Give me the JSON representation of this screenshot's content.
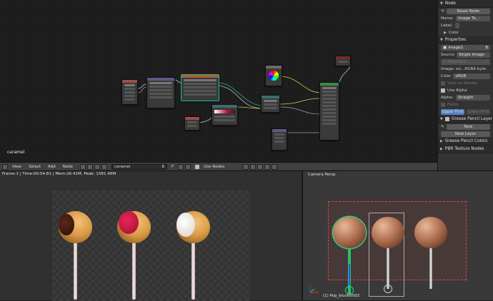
{
  "node_editor": {
    "canvas_label": "caramel",
    "header": {
      "menus": [
        "View",
        "Select",
        "Add",
        "Node"
      ],
      "material_name": "caramel",
      "user_count": "8",
      "fake_user": "F",
      "use_nodes_label": "Use Nodes"
    }
  },
  "sidebar": {
    "node_panel_title": "Node",
    "reset_button": "Reset Node",
    "name_label": "Name:",
    "name_value": "Image Te...",
    "label_label": "Label:",
    "color_title": "Color",
    "properties_title": "Properties",
    "image_name": "image2.",
    "image_users": "8",
    "source_label": "Source",
    "source_value": "Single Image",
    "path_value": "//..Structure",
    "image_info": "Image: siz...RGBA byte",
    "color_label": "Color",
    "color_value": "sRGB",
    "view_as_render": "View as Render",
    "use_alpha": "Use Alpha",
    "alpha_label": "Alpha:",
    "alpha_value": "Straight",
    "fields_label": "Fields",
    "upper_first": "Upper First",
    "lower_first": "Lower First",
    "gp_layers_title": "Grease Pencil Layer",
    "new_button": "New",
    "new_layer_button": "New Layer",
    "gp_colors_title": "Grease Pencil Colors",
    "pbr_title": "PBR Texture Nodes"
  },
  "render_view": {
    "status": "Frame:1 | Time:00:54.81 | Mem:26.41M, Peak: 1581.46M"
  },
  "viewport": {
    "camera_label": "Camera Persp",
    "object_label": "(1) Pop_bicolor002"
  },
  "colors": {
    "accent_teal": "#1fb5a5",
    "selection_orange": "#f0a030",
    "candy_orange": "#d99a45",
    "candy_red": "#c0163a"
  }
}
